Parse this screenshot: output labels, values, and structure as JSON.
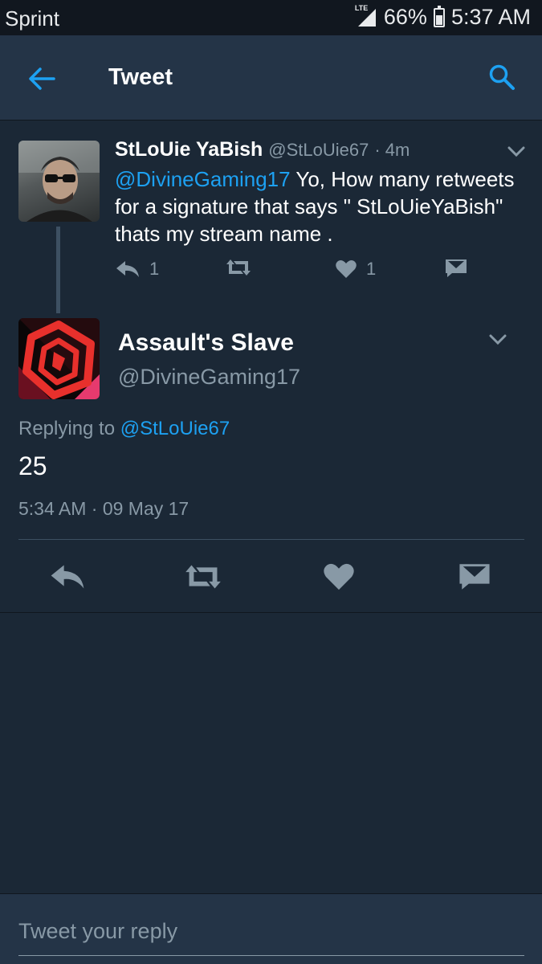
{
  "status_bar": {
    "carrier": "Sprint",
    "network": "LTE",
    "battery": "66%",
    "time": "5:37 AM"
  },
  "app_bar": {
    "title": "Tweet"
  },
  "parent_tweet": {
    "display_name": "StLoUie YaBish",
    "handle": "@StLoUie67",
    "time_ago": "· 4m",
    "mention": "@DivineGaming17",
    "text": " Yo, How many retweets for a signature that says \" StLoUieYaBish\" thats my stream name .",
    "reply_count": "1",
    "like_count": "1"
  },
  "main_tweet": {
    "display_name": "Assault's Slave",
    "handle": "@DivineGaming17",
    "replying_prefix": "Replying to ",
    "replying_to": "@StLoUie67",
    "text": "25",
    "timestamp": "5:34 AM · 09 May 17"
  },
  "reply_composer": {
    "placeholder": "Tweet your reply"
  },
  "colors": {
    "accent": "#1da1f2",
    "background": "#1b2836",
    "header": "#243447",
    "muted": "#8899a6"
  }
}
